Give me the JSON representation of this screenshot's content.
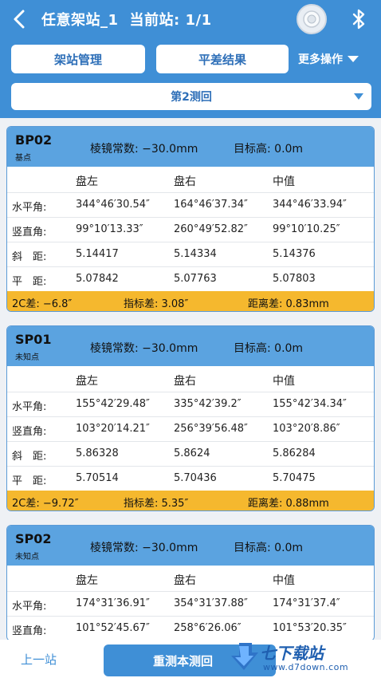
{
  "header": {
    "title": "任意架站_1",
    "station_label": "当前站:",
    "station_value": "1/1"
  },
  "actions": {
    "station_manage": "架站管理",
    "adjust_result": "平差结果",
    "more": "更多操作"
  },
  "round_select": {
    "value": "第2测回"
  },
  "table_headers": {
    "left": "盘左",
    "right": "盘右",
    "mid": "中值"
  },
  "row_labels": {
    "hz": "水平角:",
    "v": "竖直角:",
    "slope": "斜　距:",
    "hd": "平　距:"
  },
  "cards": [
    {
      "name": "BP02",
      "type": "基点",
      "prism_const": "棱镜常数: −30.0mm",
      "target_height": "目标高:  0.0m",
      "rows": [
        [
          "344°46′30.54″",
          "164°46′37.34″",
          "344°46′33.94″"
        ],
        [
          "99°10′13.33″",
          "260°49′52.82″",
          "99°10′10.25″"
        ],
        [
          "5.14417",
          "5.14334",
          "5.14376"
        ],
        [
          "5.07842",
          "5.07763",
          "5.07803"
        ]
      ],
      "footer": {
        "c2": "2C差: −6.8″",
        "index": "指标差: 3.08″",
        "dist": "距离差: 0.83mm"
      }
    },
    {
      "name": "SP01",
      "type": "未知点",
      "prism_const": "棱镜常数: −30.0mm",
      "target_height": "目标高:  0.0m",
      "rows": [
        [
          "155°42′29.48″",
          "335°42′39.2″",
          "155°42′34.34″"
        ],
        [
          "103°20′14.21″",
          "256°39′56.48″",
          "103°20′8.86″"
        ],
        [
          "5.86328",
          "5.8624",
          "5.86284"
        ],
        [
          "5.70514",
          "5.70436",
          "5.70475"
        ]
      ],
      "footer": {
        "c2": "2C差: −9.72″",
        "index": "指标差: 5.35″",
        "dist": "距离差: 0.88mm"
      }
    },
    {
      "name": "SP02",
      "type": "未知点",
      "prism_const": "棱镜常数: −30.0mm",
      "target_height": "目标高:  0.0m",
      "rows": [
        [
          "174°31′36.91″",
          "354°31′37.88″",
          "174°31′37.4″"
        ],
        [
          "101°52′45.67″",
          "258°6′26.06″",
          "101°53′20.35″"
        ]
      ]
    }
  ],
  "bottom": {
    "prev": "上一站",
    "remeasure": "重测本测回"
  },
  "watermark": {
    "title": "七下载站",
    "url": "www.d7down.com"
  },
  "colors": {
    "primary": "#3f8fd6",
    "card_header": "#5ba3e0",
    "warning": "#f5b82e"
  }
}
